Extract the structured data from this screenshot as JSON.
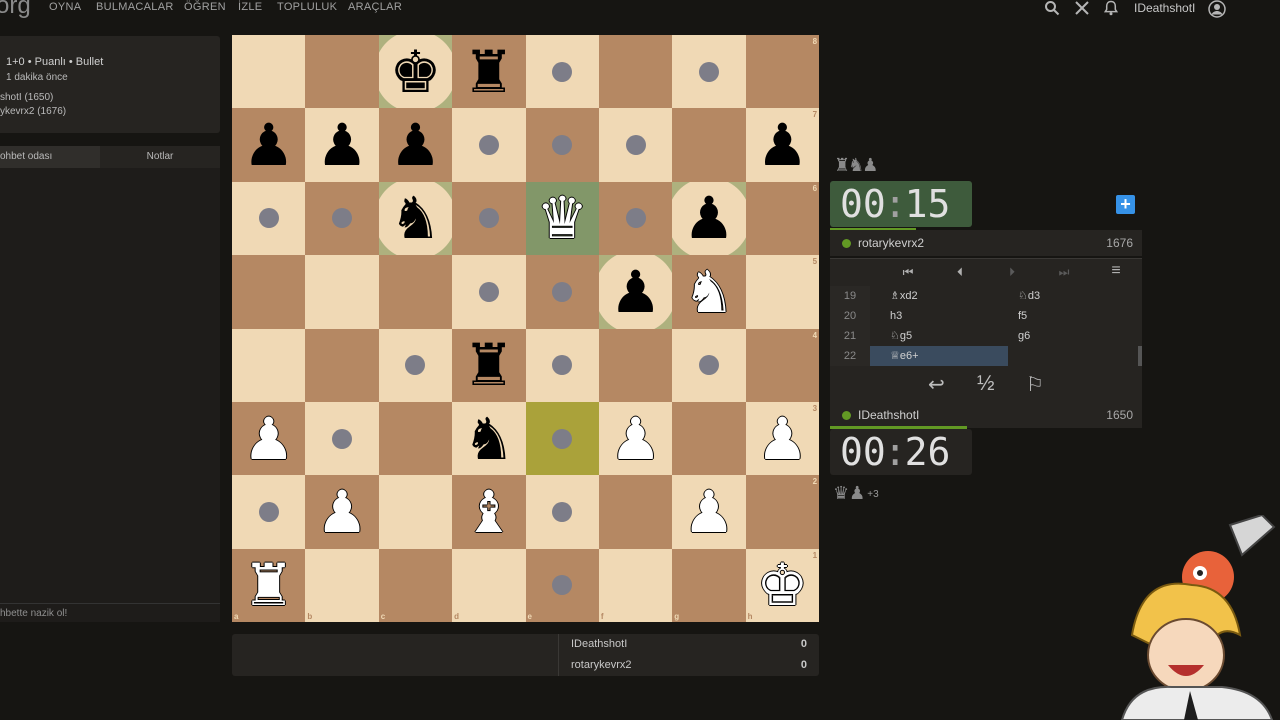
{
  "nav": {
    "logo": "org",
    "items": [
      "OYNA",
      "BULMACALAR",
      "ÖĞREN",
      "İZLE",
      "TOPLULUK",
      "ARAÇLAR"
    ],
    "username": "IDeathshotI"
  },
  "game_info": {
    "mode": "1+0 • Puanlı • Bullet",
    "started": "1 dakika önce",
    "white": "shotI (1650)",
    "black": "ykevrx2 (1676)"
  },
  "chat": {
    "tab_chat": "ohbet odası",
    "tab_notes": "Notlar",
    "input_placeholder": "hbette nazik ol!"
  },
  "board": {
    "files": [
      "a",
      "b",
      "c",
      "d",
      "e",
      "f",
      "g",
      "h"
    ],
    "ranks": [
      "8",
      "7",
      "6",
      "5",
      "4",
      "3",
      "2",
      "1"
    ],
    "colors": {
      "light": "#f0d9b5",
      "dark": "#b58863",
      "last_move": "#829769",
      "selected": "#aaa23a"
    },
    "pieces": {
      "c8": "bK",
      "d8": "bR",
      "a7": "bP",
      "b7": "bP",
      "c7": "bP",
      "h7": "bP",
      "c6": "bN",
      "e6": "wQ",
      "g6": "bP",
      "f5": "bP",
      "g5": "wN",
      "d4": "bR",
      "a3": "wP",
      "d3": "bN",
      "f3": "wP",
      "h3": "wP",
      "b2": "wP",
      "d2": "wB",
      "g2": "wP",
      "a1": "wR",
      "h1": "wK"
    },
    "highlights": {
      "e6": "last_move",
      "e3": "selected"
    },
    "move_dots": [
      "e8",
      "g8",
      "d7",
      "e7",
      "f7",
      "a6",
      "b6",
      "d6",
      "f6",
      "d5",
      "e5",
      "c4",
      "e4",
      "g4",
      "b3",
      "e3",
      "a2",
      "e2",
      "e1"
    ],
    "capture_targets": [
      "c8",
      "c6",
      "g6",
      "f5"
    ]
  },
  "opponent": {
    "name": "rotarykevrx2",
    "rating": "1676",
    "clock_min": "00",
    "clock_sec": "15",
    "material": "♜♞♟"
  },
  "player": {
    "name": "IDeathshotI",
    "rating": "1650",
    "clock_min": "00",
    "clock_sec": "26",
    "material": "♛♟",
    "material_diff": "+3"
  },
  "moves": [
    {
      "num": "19",
      "white": "♗xd2",
      "black": "♘d3"
    },
    {
      "num": "20",
      "white": "h3",
      "black": "f5"
    },
    {
      "num": "21",
      "white": "♘g5",
      "black": "g6"
    },
    {
      "num": "22",
      "white": "♕e6+",
      "black": ""
    }
  ],
  "controls": {
    "first": "⏮",
    "prev": "⏴",
    "next": "⏵",
    "last": "⏭",
    "menu": "≡"
  },
  "actions": {
    "takeback": "↩",
    "draw": "½",
    "resign": "⚐"
  },
  "crosstable": [
    {
      "name": "IDeathshotI",
      "score": "0"
    },
    {
      "name": "rotarykevrx2",
      "score": "0"
    }
  ]
}
